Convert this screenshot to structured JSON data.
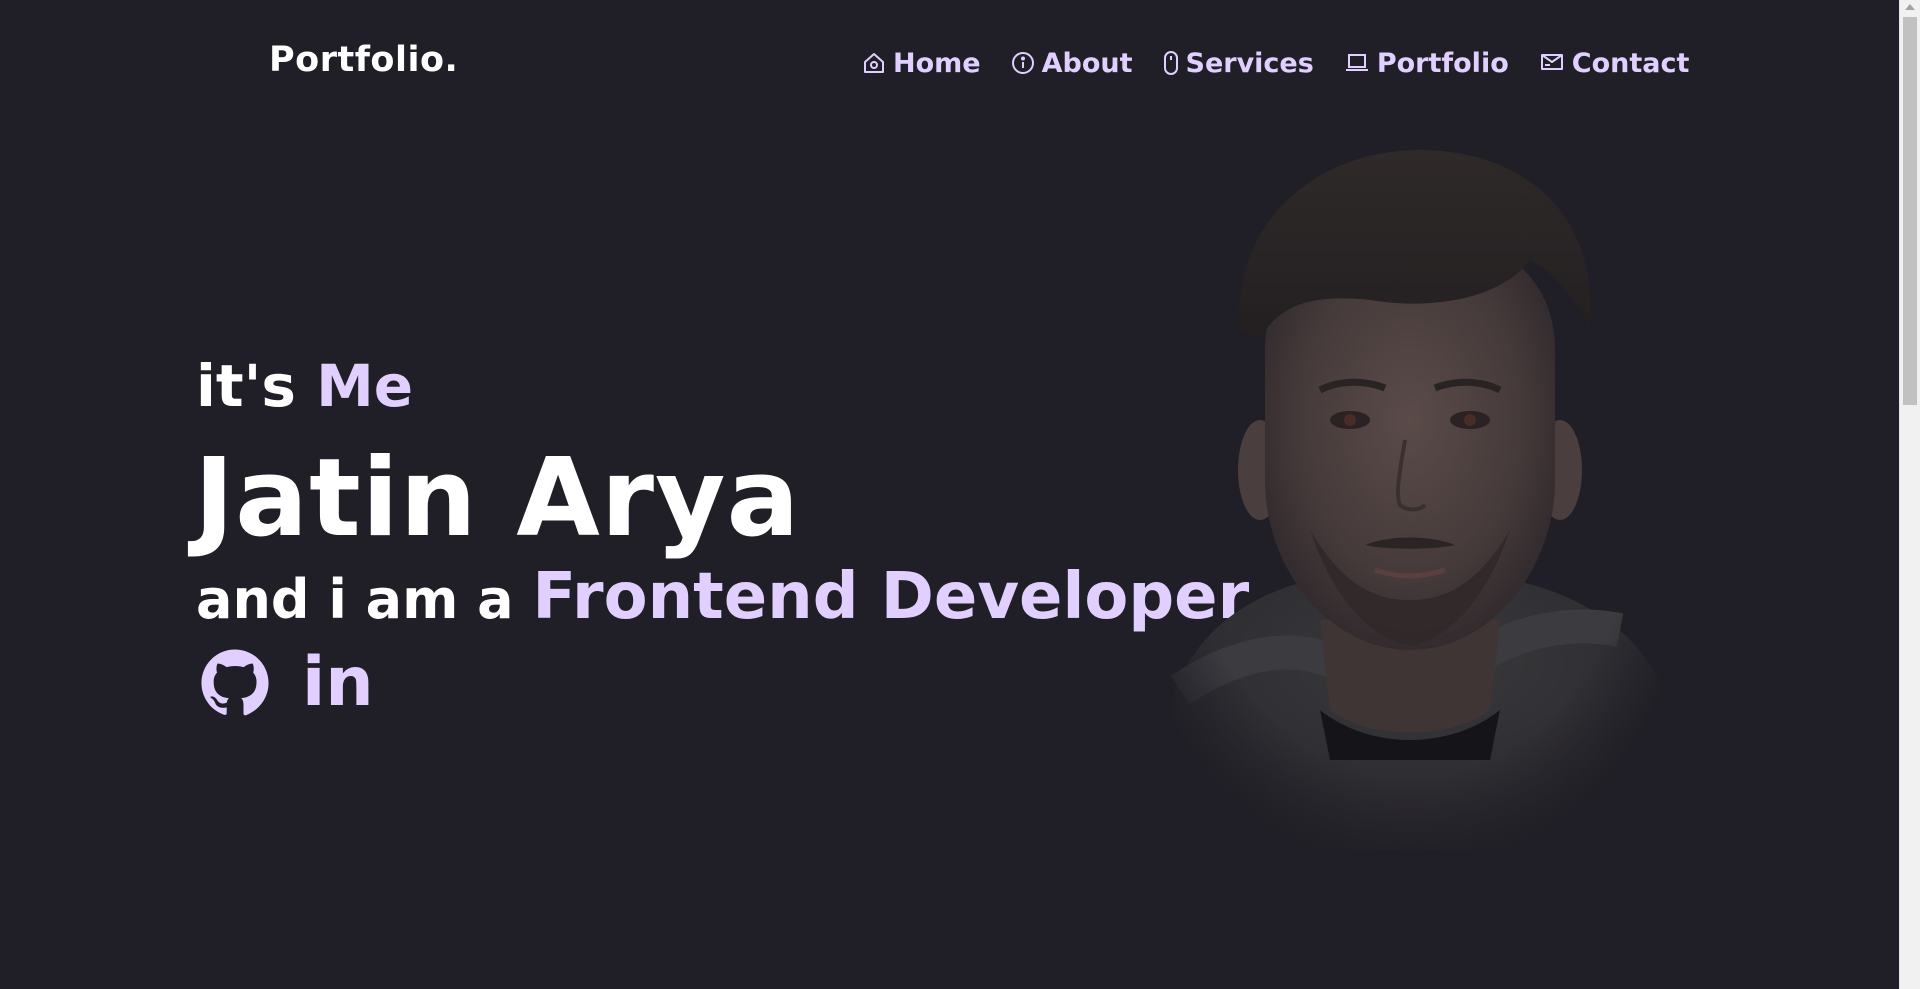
{
  "header": {
    "logo": "Portfolio.",
    "nav": [
      {
        "label": "Home",
        "icon": "home-icon"
      },
      {
        "label": "About",
        "icon": "info-icon"
      },
      {
        "label": "Services",
        "icon": "mouse-icon"
      },
      {
        "label": "Portfolio",
        "icon": "laptop-icon"
      },
      {
        "label": "Contact",
        "icon": "mail-icon"
      }
    ]
  },
  "hero": {
    "intro_prefix": "it's ",
    "intro_accent": "Me",
    "name": "Jatin Arya",
    "role_prefix": "and i am a ",
    "role": "Frontend Developer",
    "socials": [
      {
        "name": "github",
        "icon": "github-icon"
      },
      {
        "name": "linkedin",
        "label": "in",
        "icon": "linkedin-icon"
      }
    ]
  },
  "colors": {
    "background": "#201e26",
    "accent": "#e1cfff",
    "text": "#ffffff"
  }
}
